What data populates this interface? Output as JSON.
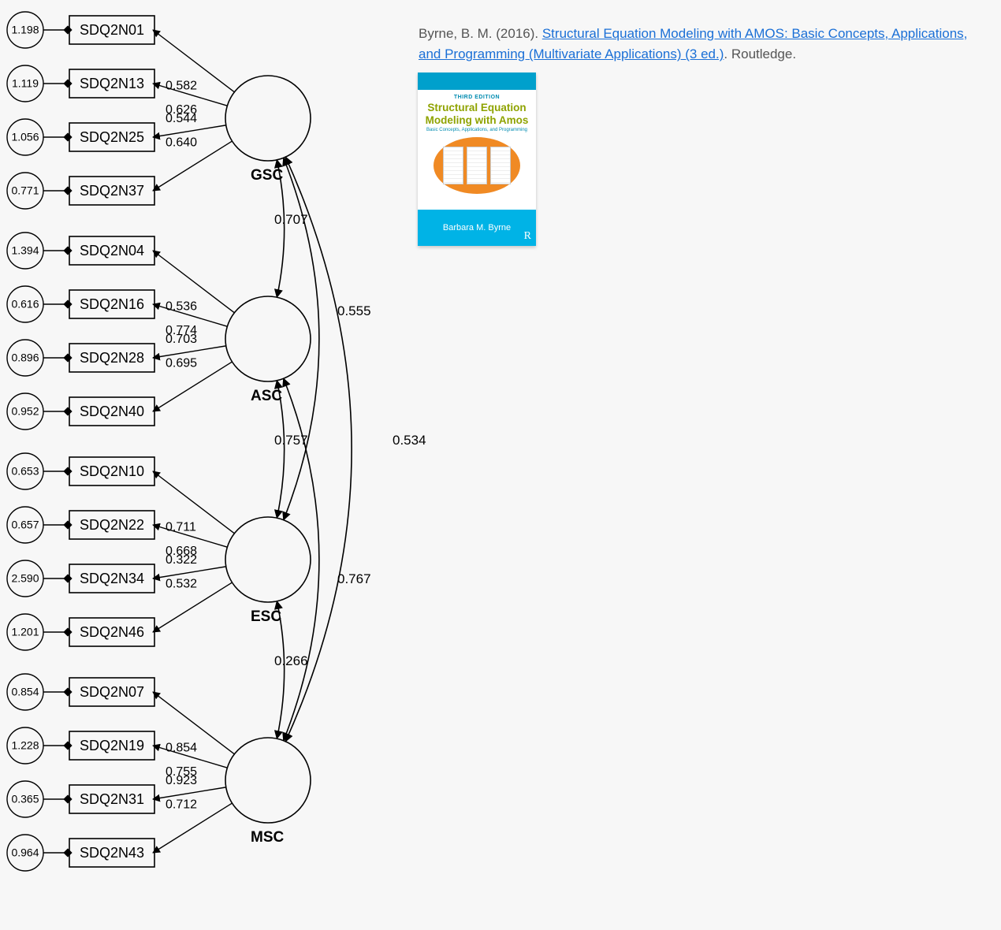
{
  "citation": {
    "author_year": "Byrne, B. M. (2016). ",
    "link_text": "Structural Equation Modeling with AMOS: Basic Concepts, Applications, and Programming (Multivariate Applications) (3 ed.)",
    "trailing": ". Routledge."
  },
  "book_cover": {
    "edition": "THIRD EDITION",
    "title_line1": "Structural Equation",
    "title_line2": "Modeling with Amos",
    "subtitle": "Basic Concepts, Applications, and Programming",
    "author": "Barbara M. Byrne",
    "publisher_mark": "R"
  },
  "factors": [
    {
      "id": "GSC",
      "label": "GSC",
      "indicators": [
        {
          "name": "SDQ2N01",
          "loading": "0.582",
          "error": "1.198"
        },
        {
          "name": "SDQ2N13",
          "loading": "0.626",
          "error": "1.119"
        },
        {
          "name": "SDQ2N25",
          "loading": "0.544",
          "error": "1.056"
        },
        {
          "name": "SDQ2N37",
          "loading": "0.640",
          "error": "0.771"
        }
      ]
    },
    {
      "id": "ASC",
      "label": "ASC",
      "indicators": [
        {
          "name": "SDQ2N04",
          "loading": "0.536",
          "error": "1.394"
        },
        {
          "name": "SDQ2N16",
          "loading": "0.774",
          "error": "0.616"
        },
        {
          "name": "SDQ2N28",
          "loading": "0.703",
          "error": "0.896"
        },
        {
          "name": "SDQ2N40",
          "loading": "0.695",
          "error": "0.952"
        }
      ]
    },
    {
      "id": "ESC",
      "label": "ESC",
      "indicators": [
        {
          "name": "SDQ2N10",
          "loading": "0.711",
          "error": "0.653"
        },
        {
          "name": "SDQ2N22",
          "loading": "0.668",
          "error": "0.657"
        },
        {
          "name": "SDQ2N34",
          "loading": "0.322",
          "error": "2.590"
        },
        {
          "name": "SDQ2N46",
          "loading": "0.532",
          "error": "1.201"
        }
      ]
    },
    {
      "id": "MSC",
      "label": "MSC",
      "indicators": [
        {
          "name": "SDQ2N07",
          "loading": "0.854",
          "error": "0.854"
        },
        {
          "name": "SDQ2N19",
          "loading": "0.755",
          "error": "1.228"
        },
        {
          "name": "SDQ2N31",
          "loading": "0.923",
          "error": "0.365"
        },
        {
          "name": "SDQ2N43",
          "loading": "0.712",
          "error": "0.964"
        }
      ]
    }
  ],
  "covariances": [
    {
      "between": [
        "GSC",
        "ASC"
      ],
      "value": "0.707"
    },
    {
      "between": [
        "ASC",
        "ESC"
      ],
      "value": "0.757"
    },
    {
      "between": [
        "ESC",
        "MSC"
      ],
      "value": "0.266"
    },
    {
      "between": [
        "GSC",
        "ESC"
      ],
      "value": "0.555"
    },
    {
      "between": [
        "ASC",
        "MSC"
      ],
      "value": "0.767"
    },
    {
      "between": [
        "GSC",
        "MSC"
      ],
      "value": "0.534"
    }
  ]
}
